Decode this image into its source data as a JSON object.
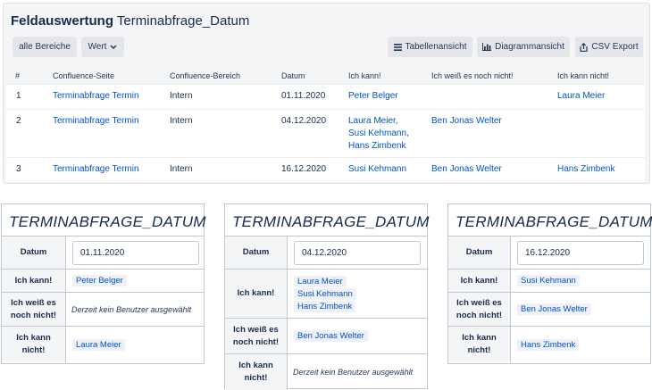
{
  "header": {
    "title_bold": "Feldauswertung",
    "title_rest": "Terminabfrage_Datum"
  },
  "toolbar": {
    "all_areas": "alle Bereiche",
    "value": "Wert",
    "table_view": "Tabellenansicht",
    "chart_view": "Diagrammansicht",
    "csv_export": "CSV Export"
  },
  "table": {
    "columns": [
      "#",
      "Confluence-Seite",
      "Confluence-Bereich",
      "Datum",
      "Ich kann!",
      "Ich weiß es noch nicht!",
      "Ich kann nicht!"
    ],
    "rows": [
      {
        "num": "1",
        "page": "Terminabfrage Termin",
        "space": "Intern",
        "date": "01.11.2020",
        "can": [
          "Peter Belger"
        ],
        "unsure": [],
        "cannot": [
          "Laura Meier"
        ]
      },
      {
        "num": "2",
        "page": "Terminabfrage Termin",
        "space": "Intern",
        "date": "04.12.2020",
        "can": [
          "Laura Meier,",
          "Susi Kehmann,",
          "Hans Zimbenk"
        ],
        "unsure": [
          "Ben Jonas Welter"
        ],
        "cannot": []
      },
      {
        "num": "3",
        "page": "Terminabfrage Termin",
        "space": "Intern",
        "date": "16.12.2020",
        "can": [
          "Susi Kehmann"
        ],
        "unsure": [
          "Ben Jonas Welter"
        ],
        "cannot": [
          "Hans Zimbenk"
        ]
      }
    ]
  },
  "card_labels": {
    "date": "Datum",
    "can": "Ich kann!",
    "unsure": "Ich weiß es noch nicht!",
    "cannot": "Ich kann nicht!",
    "no_user": "Derzeit kein Benutzer ausgewählt"
  },
  "cards": [
    {
      "title": "TERMINABFRAGE_DATUM",
      "date": "01.11.2020",
      "can": [
        "Peter Belger"
      ],
      "unsure": [],
      "cannot": [
        "Laura Meier"
      ]
    },
    {
      "title": "TERMINABFRAGE_DATUM",
      "date": "04.12.2020",
      "can": [
        "Laura Meier",
        "Susi Kehmann",
        "Hans Zimbenk"
      ],
      "unsure": [
        "Ben Jonas Welter"
      ],
      "cannot": []
    },
    {
      "title": "TERMINABFRAGE_DATUM",
      "date": "16.12.2020",
      "can": [
        "Susi Kehmann"
      ],
      "unsure": [
        "Ben Jonas Welter"
      ],
      "cannot": [
        "Hans Zimbenk"
      ]
    }
  ],
  "colors": {
    "link": "#0052cc",
    "chip_bg": "#eef1f6",
    "panel_bg": "#f4f5f7"
  },
  "icons": {
    "value_dropdown": "chevron-down-icon",
    "table_view": "list-icon",
    "chart_view": "bar-chart-icon",
    "csv_export": "export-icon"
  }
}
